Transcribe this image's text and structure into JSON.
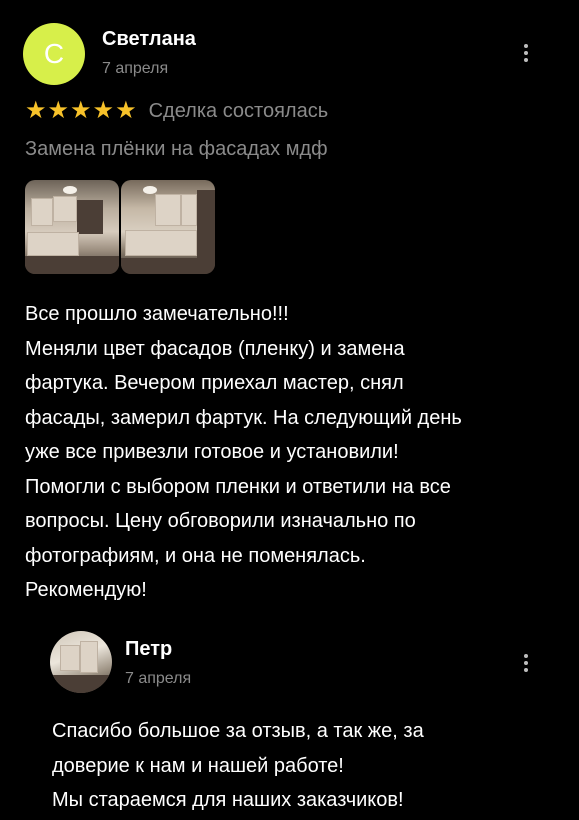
{
  "review": {
    "avatar_letter": "С",
    "avatar_color": "#d7ef4a",
    "author": "Светлана",
    "date": "7 апреля",
    "rating": 5,
    "star_color": "#f7c22a",
    "deal_status": "Сделка состоялась",
    "service": "Замена плёнки на фасадах мдф",
    "photos": [
      "kitchen-photo-1",
      "kitchen-photo-2"
    ],
    "text_lines": [
      "Все прошло замечательно!!!",
      "Меняли цвет фасадов (пленку) и замена",
      "фартука. Вечером приехал мастер, снял",
      "фасады, замерил фартук. На следующий день",
      "уже все привезли готовое и установили!",
      "Помогли с выбором пленки и ответили на все",
      "вопросы. Цену обговорили изначально по",
      "фотографиям, и она не поменялась.",
      "Рекомендую!"
    ],
    "menu_icon": "more-vertical-icon"
  },
  "reply": {
    "author": "Петр",
    "date": "7 апреля",
    "text_lines": [
      "Спасибо большое за отзыв, а так же, за",
      "доверие к нам и нашей работе!",
      "Мы стараемся для наших заказчиков!"
    ],
    "menu_icon": "more-vertical-icon"
  }
}
